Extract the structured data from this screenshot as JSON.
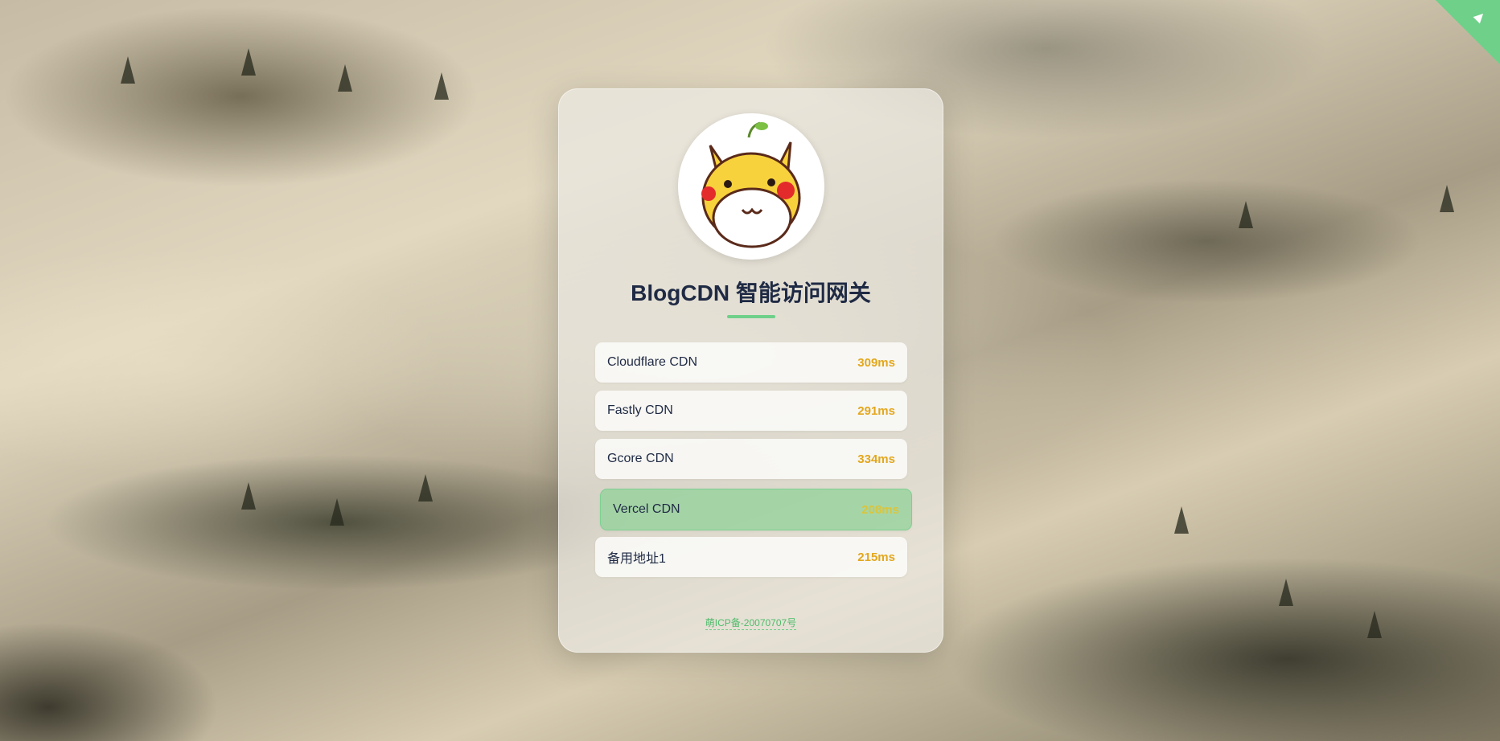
{
  "page": {
    "title": "BlogCDN 智能访问网关",
    "accent_color": "#6fd08a",
    "corner_icon": "github-octocat-icon"
  },
  "avatar": {
    "icon": "pikachu-avatar"
  },
  "cdn_nodes": [
    {
      "name": "Cloudflare CDN",
      "latency": "309ms",
      "selected": false
    },
    {
      "name": "Fastly CDN",
      "latency": "291ms",
      "selected": false
    },
    {
      "name": "Gcore CDN",
      "latency": "334ms",
      "selected": false
    },
    {
      "name": "Vercel CDN",
      "latency": "208ms",
      "selected": true
    },
    {
      "name": "备用地址1",
      "latency": "215ms",
      "selected": false
    }
  ],
  "footer": {
    "icp": "萌ICP备-20070707号"
  }
}
